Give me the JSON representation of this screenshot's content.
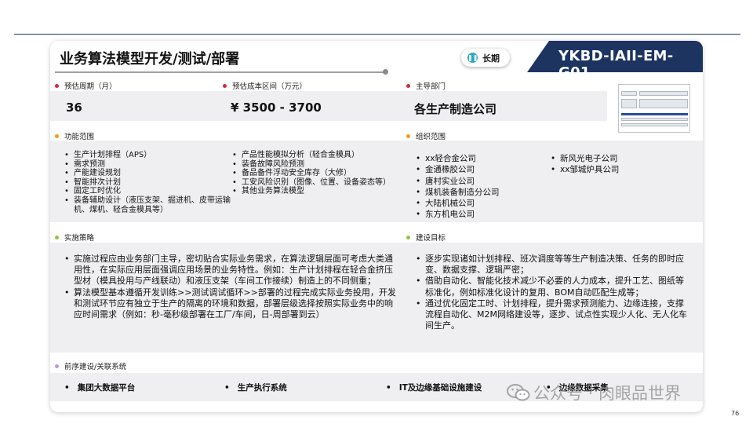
{
  "header": {
    "title": "业务算法模型开发/测试/部署",
    "term": "长期",
    "code": "YKBD-IAII-EM-G01"
  },
  "period": {
    "label": "预估周期（月）",
    "value": "36"
  },
  "cost": {
    "label": "预估成本区间（万元）",
    "value": "¥ 3500 - 3700"
  },
  "dept": {
    "label": "主导部门",
    "value": "各生产制造公司"
  },
  "scope": {
    "label": "功能范围",
    "col1": [
      "生产计划排程（APS）",
      "需求预测",
      "产能建设规划",
      "智能排次计划",
      "固定工时优化",
      "装备辅助设计（液压支架、掘进机、皮带运输机、煤机、轻合金模具等）"
    ],
    "col2": [
      "产品性能模拟分析（轻合金模具）",
      "装备故障风险预测",
      "备品备件浮动安全库存（大修）",
      "工安风险识别（图像、位置、设备姿态等）",
      "其他业务算法模型"
    ]
  },
  "orgs": {
    "label": "组织范围",
    "col1": [
      "xx轻合金公司",
      "金通橡胶公司",
      "唐村实业公司",
      "煤机装备制造分公司",
      "大陆机械公司",
      "东方机电公司"
    ],
    "col2": [
      "新风光电子公司",
      "xx邹城炉具公司"
    ]
  },
  "strategy": {
    "label": "实施策略",
    "items": [
      "实施过程应由业务部门主导，密切贴合实际业务需求，在算法逻辑层面可考虑大类通用性，在实际应用层面强调应用场景的业务特性。例如：生产计划排程在轻合金挤压型材（模具投用与产线联动）和液压支架（车间工作接续）制造上的不同侧重；",
      "算法模型基本遵循开发训练>>测试调试循环>>部署的过程完成实际业务投用，开发和测试环节应有独立于生产的隔离的环境和数据，部署层级选择按照实际业务中的响应时间需求（例如：秒-毫秒级部署在工厂/车间，日-周部署到云）"
    ]
  },
  "goals": {
    "label": "建设目标",
    "items": [
      "逐步实现诸如计划排程、班次调度等等生产制造决策、任务的即时应变、数据支撑、逻辑严密；",
      "借助自动化、智能化技术减少不必要的人力成本，提升工艺、图纸等标准化，例如标准化设计的复用、BOM自动匹配生成等；",
      "通过优化固定工时、计划排程，提升需求预测能力、边缘连接，支撑流程自动化、M2M网络建设等，逐步、试点性实现少人化、无人化车间生产。"
    ]
  },
  "prereq": {
    "label": "前序建设/关联系统",
    "items": [
      "集团大数据平台",
      "生产执行系统",
      "IT及边缘基础设施建设",
      "边缘数据采集"
    ]
  },
  "watermark": "公众号 · 肉眼品世界",
  "page_number": "76",
  "colors": {
    "navy": "#1d3461",
    "dot_red": "#d62a3c",
    "dot_orange": "#f39a1e",
    "dot_green": "#8cc63f",
    "dot_purple": "#b99ae0",
    "band": "#efeff2"
  }
}
